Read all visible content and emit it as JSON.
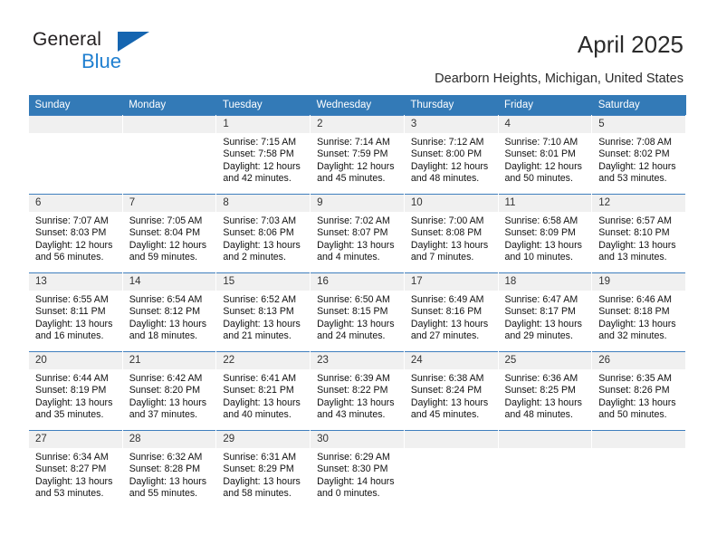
{
  "brand": {
    "name_top": "General",
    "name_bottom": "Blue",
    "triangle_color": "#1565b0",
    "blue_color": "#1f7fd0"
  },
  "header": {
    "title": "April 2025",
    "location": "Dearborn Heights, Michigan, United States",
    "header_bg": "#337ab7",
    "daycell_bg": "#f0f0f0"
  },
  "calendar": {
    "weekdays": [
      "Sunday",
      "Monday",
      "Tuesday",
      "Wednesday",
      "Thursday",
      "Friday",
      "Saturday"
    ],
    "weeks": [
      [
        {
          "day": "",
          "sunrise": "",
          "sunset": "",
          "daylight": "",
          "blank": true
        },
        {
          "day": "",
          "sunrise": "",
          "sunset": "",
          "daylight": "",
          "blank": true
        },
        {
          "day": "1",
          "sunrise": "Sunrise: 7:15 AM",
          "sunset": "Sunset: 7:58 PM",
          "daylight": "Daylight: 12 hours and 42 minutes."
        },
        {
          "day": "2",
          "sunrise": "Sunrise: 7:14 AM",
          "sunset": "Sunset: 7:59 PM",
          "daylight": "Daylight: 12 hours and 45 minutes."
        },
        {
          "day": "3",
          "sunrise": "Sunrise: 7:12 AM",
          "sunset": "Sunset: 8:00 PM",
          "daylight": "Daylight: 12 hours and 48 minutes."
        },
        {
          "day": "4",
          "sunrise": "Sunrise: 7:10 AM",
          "sunset": "Sunset: 8:01 PM",
          "daylight": "Daylight: 12 hours and 50 minutes."
        },
        {
          "day": "5",
          "sunrise": "Sunrise: 7:08 AM",
          "sunset": "Sunset: 8:02 PM",
          "daylight": "Daylight: 12 hours and 53 minutes."
        }
      ],
      [
        {
          "day": "6",
          "sunrise": "Sunrise: 7:07 AM",
          "sunset": "Sunset: 8:03 PM",
          "daylight": "Daylight: 12 hours and 56 minutes."
        },
        {
          "day": "7",
          "sunrise": "Sunrise: 7:05 AM",
          "sunset": "Sunset: 8:04 PM",
          "daylight": "Daylight: 12 hours and 59 minutes."
        },
        {
          "day": "8",
          "sunrise": "Sunrise: 7:03 AM",
          "sunset": "Sunset: 8:06 PM",
          "daylight": "Daylight: 13 hours and 2 minutes."
        },
        {
          "day": "9",
          "sunrise": "Sunrise: 7:02 AM",
          "sunset": "Sunset: 8:07 PM",
          "daylight": "Daylight: 13 hours and 4 minutes."
        },
        {
          "day": "10",
          "sunrise": "Sunrise: 7:00 AM",
          "sunset": "Sunset: 8:08 PM",
          "daylight": "Daylight: 13 hours and 7 minutes."
        },
        {
          "day": "11",
          "sunrise": "Sunrise: 6:58 AM",
          "sunset": "Sunset: 8:09 PM",
          "daylight": "Daylight: 13 hours and 10 minutes."
        },
        {
          "day": "12",
          "sunrise": "Sunrise: 6:57 AM",
          "sunset": "Sunset: 8:10 PM",
          "daylight": "Daylight: 13 hours and 13 minutes."
        }
      ],
      [
        {
          "day": "13",
          "sunrise": "Sunrise: 6:55 AM",
          "sunset": "Sunset: 8:11 PM",
          "daylight": "Daylight: 13 hours and 16 minutes."
        },
        {
          "day": "14",
          "sunrise": "Sunrise: 6:54 AM",
          "sunset": "Sunset: 8:12 PM",
          "daylight": "Daylight: 13 hours and 18 minutes."
        },
        {
          "day": "15",
          "sunrise": "Sunrise: 6:52 AM",
          "sunset": "Sunset: 8:13 PM",
          "daylight": "Daylight: 13 hours and 21 minutes."
        },
        {
          "day": "16",
          "sunrise": "Sunrise: 6:50 AM",
          "sunset": "Sunset: 8:15 PM",
          "daylight": "Daylight: 13 hours and 24 minutes."
        },
        {
          "day": "17",
          "sunrise": "Sunrise: 6:49 AM",
          "sunset": "Sunset: 8:16 PM",
          "daylight": "Daylight: 13 hours and 27 minutes."
        },
        {
          "day": "18",
          "sunrise": "Sunrise: 6:47 AM",
          "sunset": "Sunset: 8:17 PM",
          "daylight": "Daylight: 13 hours and 29 minutes."
        },
        {
          "day": "19",
          "sunrise": "Sunrise: 6:46 AM",
          "sunset": "Sunset: 8:18 PM",
          "daylight": "Daylight: 13 hours and 32 minutes."
        }
      ],
      [
        {
          "day": "20",
          "sunrise": "Sunrise: 6:44 AM",
          "sunset": "Sunset: 8:19 PM",
          "daylight": "Daylight: 13 hours and 35 minutes."
        },
        {
          "day": "21",
          "sunrise": "Sunrise: 6:42 AM",
          "sunset": "Sunset: 8:20 PM",
          "daylight": "Daylight: 13 hours and 37 minutes."
        },
        {
          "day": "22",
          "sunrise": "Sunrise: 6:41 AM",
          "sunset": "Sunset: 8:21 PM",
          "daylight": "Daylight: 13 hours and 40 minutes."
        },
        {
          "day": "23",
          "sunrise": "Sunrise: 6:39 AM",
          "sunset": "Sunset: 8:22 PM",
          "daylight": "Daylight: 13 hours and 43 minutes."
        },
        {
          "day": "24",
          "sunrise": "Sunrise: 6:38 AM",
          "sunset": "Sunset: 8:24 PM",
          "daylight": "Daylight: 13 hours and 45 minutes."
        },
        {
          "day": "25",
          "sunrise": "Sunrise: 6:36 AM",
          "sunset": "Sunset: 8:25 PM",
          "daylight": "Daylight: 13 hours and 48 minutes."
        },
        {
          "day": "26",
          "sunrise": "Sunrise: 6:35 AM",
          "sunset": "Sunset: 8:26 PM",
          "daylight": "Daylight: 13 hours and 50 minutes."
        }
      ],
      [
        {
          "day": "27",
          "sunrise": "Sunrise: 6:34 AM",
          "sunset": "Sunset: 8:27 PM",
          "daylight": "Daylight: 13 hours and 53 minutes."
        },
        {
          "day": "28",
          "sunrise": "Sunrise: 6:32 AM",
          "sunset": "Sunset: 8:28 PM",
          "daylight": "Daylight: 13 hours and 55 minutes."
        },
        {
          "day": "29",
          "sunrise": "Sunrise: 6:31 AM",
          "sunset": "Sunset: 8:29 PM",
          "daylight": "Daylight: 13 hours and 58 minutes."
        },
        {
          "day": "30",
          "sunrise": "Sunrise: 6:29 AM",
          "sunset": "Sunset: 8:30 PM",
          "daylight": "Daylight: 14 hours and 0 minutes."
        },
        {
          "day": "",
          "sunrise": "",
          "sunset": "",
          "daylight": "",
          "blank": true
        },
        {
          "day": "",
          "sunrise": "",
          "sunset": "",
          "daylight": "",
          "blank": true
        },
        {
          "day": "",
          "sunrise": "",
          "sunset": "",
          "daylight": "",
          "blank": true
        }
      ]
    ]
  }
}
